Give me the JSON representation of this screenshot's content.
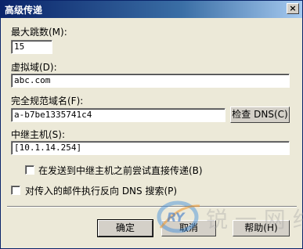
{
  "window": {
    "title": "高级传递",
    "close_symbol": "×"
  },
  "fields": {
    "max_hops": {
      "label": "最大跳数(M):",
      "value": "15"
    },
    "virtual_domain": {
      "label": "虚拟域(D):",
      "value": "abc.com"
    },
    "fqdn": {
      "label": "完全规范域名(F):",
      "value": "a-b7be1335741c4"
    },
    "smart_host": {
      "label": "中继主机(S):",
      "value": "[10.1.14.254]"
    }
  },
  "buttons": {
    "check_dns": "检查 DNS(C)",
    "ok": "确定",
    "cancel": "取消",
    "help": "帮助(H)"
  },
  "checkboxes": {
    "direct_before_smarthost": "在发送到中继主机之前尝试直接传递(B)",
    "reverse_dns": "对传入的邮件执行反向 DNS 搜索(P)"
  },
  "watermark": {
    "logo": "RY",
    "text": "锐 一 网 络"
  }
}
